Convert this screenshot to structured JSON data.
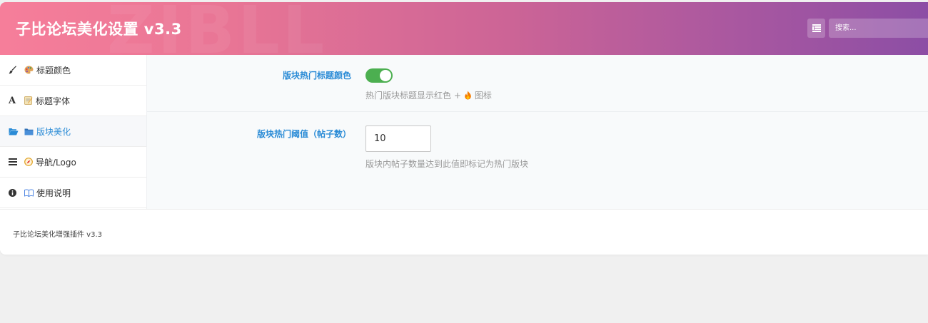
{
  "header": {
    "title": "子比论坛美化设置 v3.3",
    "watermark": "ZIBLL",
    "search_placeholder": "搜索..."
  },
  "sidebar": {
    "items": [
      {
        "label": "标题颜色",
        "icon": "paintbrush-icon",
        "emoji": "palette-icon",
        "active": false
      },
      {
        "label": "标题字体",
        "icon": "font-icon",
        "emoji": "memo-icon",
        "active": false
      },
      {
        "label": "版块美化",
        "icon": "folder-open-icon",
        "emoji": "folder-icon",
        "active": true
      },
      {
        "label": "导航/Logo",
        "icon": "bars-icon",
        "emoji": "compass-icon",
        "active": false
      },
      {
        "label": "使用说明",
        "icon": "info-circle-icon",
        "emoji": "book-icon",
        "active": false
      }
    ]
  },
  "fields": {
    "hot_title_color": {
      "label": "版块热门标题颜色",
      "enabled": true,
      "desc_before": "热门版块标题显示红色 +",
      "desc_after": "图标"
    },
    "hot_threshold": {
      "label": "版块热门阈值（帖子数）",
      "value": "10",
      "desc": "版块内帖子数量达到此值即标记为热门版块"
    }
  },
  "footer": {
    "text": "子比论坛美化增强插件 v3.3"
  },
  "colors": {
    "accent": "#2a8bd6",
    "toggle_on": "#4caf50",
    "header_start": "#f67e9a",
    "header_end": "#8c4ea5"
  }
}
